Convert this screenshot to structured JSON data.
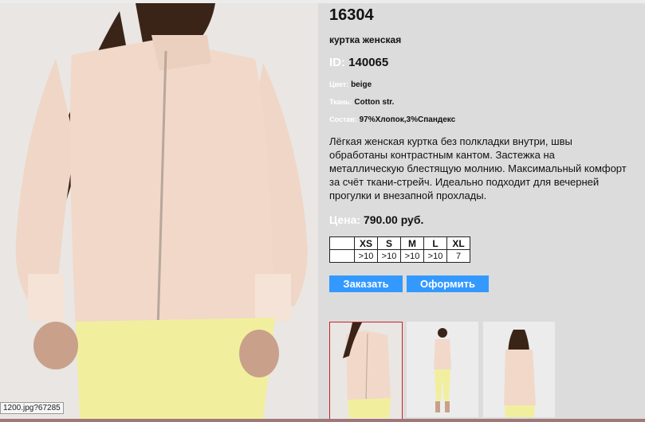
{
  "product": {
    "code": "16304",
    "title": "куртка женская",
    "id_label": "ID:",
    "id_value": "140065",
    "color_label": "Цвет:",
    "color_value": "beige",
    "fabric_label": "Ткань:",
    "fabric_value": "Cotton str.",
    "composition_label": "Состав:",
    "composition_value": "97%Хлопок,3%Спандекс",
    "description": "Лёгкая женская куртка без полкладки внутри, швы обработаны контрастным кантом. Застежка на металлическую блестящую молнию. Максимальный комфорт за счёт ткани-стрейч. Идеально подходит для вечерней прогулки и внезапной прохлады.",
    "price_label": "Цена:",
    "price_value": "790.00 руб."
  },
  "sizes": {
    "headers": [
      "",
      "XS",
      "S",
      "M",
      "L",
      "XL"
    ],
    "stock": [
      "",
      ">10",
      ">10",
      ">10",
      ">10",
      "7"
    ]
  },
  "buttons": {
    "order": "Заказать",
    "checkout": "Оформить"
  },
  "statusbar": {
    "url": "1200.jpg?67285"
  },
  "colors": {
    "accent": "#3399ff",
    "panel_bg": "#dcdcdc",
    "thumb_border": "#cc2222",
    "jacket": "#f1d8c9",
    "pants": "#f1ef9e"
  }
}
